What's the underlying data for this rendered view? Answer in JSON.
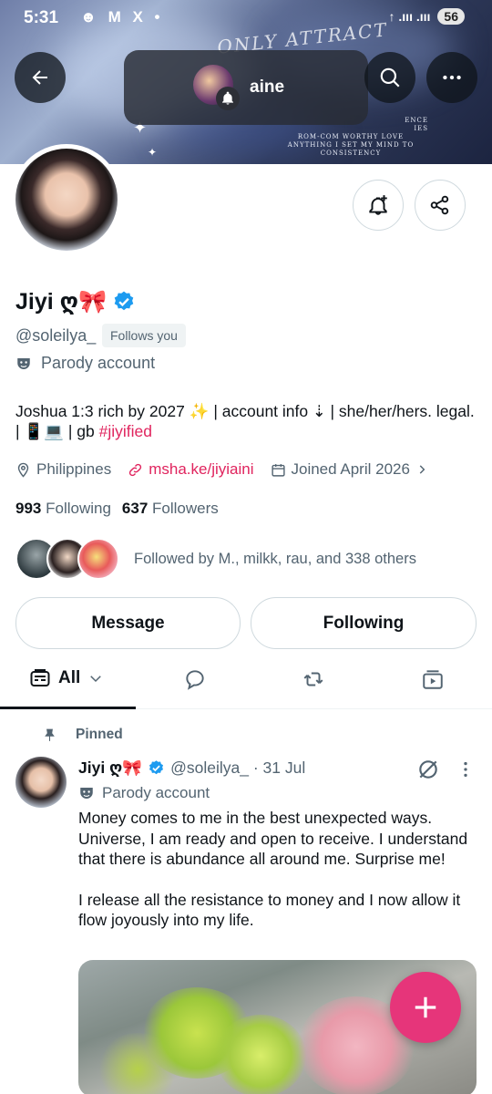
{
  "status_bar": {
    "time": "5:31",
    "app_icons": "☻ M X •",
    "signal": "↑ .ııı .ııı",
    "battery": "56"
  },
  "banner": {
    "title": "ONLY ATTRACT",
    "lines": [
      "ENCE",
      "IES",
      "ROM-COM WORTHY LOVE",
      "ANYTHING I SET MY MIND TO",
      "CONSISTENCY"
    ]
  },
  "top_nav": {
    "pill_name": "aine"
  },
  "profile": {
    "display_name": "Jiyi ღ🎀",
    "handle": "@soleilya_",
    "follows_you": "Follows you",
    "parody_label": "Parody account",
    "bio_text": "Joshua 1:3 rich by 2027 ✨ | account info ⇣ | she/her/hers. legal. | 📱💻 | gb ",
    "bio_hashtag": "#jiyified",
    "location": "Philippines",
    "website": "msha.ke/jiyiaini",
    "joined": "Joined April 2026",
    "following_count": "993",
    "following_label": "Following",
    "followers_count": "637",
    "followers_label": "Followers",
    "followed_by": "Followed by M., milkk, rau, and 338 others"
  },
  "actions": {
    "message": "Message",
    "following": "Following"
  },
  "tabs": {
    "all": "All"
  },
  "tweet": {
    "pinned": "Pinned",
    "name": "Jiyi ღ🎀",
    "handle_time": "@soleilya_ · 31 Jul",
    "parody_label": "Parody account",
    "para1": "Money comes to me in the best unexpected ways. Universe, I am ready and open to receive. I understand that there is abundance all around me. Surprise me!",
    "para2": "I release all the resistance to money and I now allow it flow joyously into my life."
  },
  "colors": {
    "accent": "#e0245e",
    "verified": "#1d9bf0",
    "fab": "#e6357a"
  }
}
